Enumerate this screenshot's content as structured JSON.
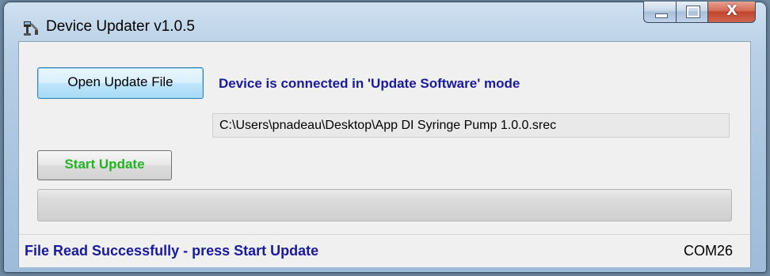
{
  "window": {
    "title": "Device Updater v1.0.5",
    "icon": "device-tool-icon"
  },
  "caption_buttons": {
    "minimize_icon": "minimize-icon",
    "maximize_icon": "maximize-icon",
    "close_label": "X"
  },
  "main": {
    "open_button_label": "Open Update File",
    "connection_status": "Device is connected in 'Update Software' mode",
    "file_path": "C:\\Users\\pnadeau\\Desktop\\App DI Syringe Pump 1.0.0.srec",
    "start_button_label": "Start Update",
    "progress_fraction": 0
  },
  "statusbar": {
    "message": "File Read Successfully - press Start Update",
    "port": "COM26"
  },
  "colors": {
    "status_text": "#1a1a9e",
    "start_button_text": "#22b422",
    "close_button": "#c0452e"
  }
}
